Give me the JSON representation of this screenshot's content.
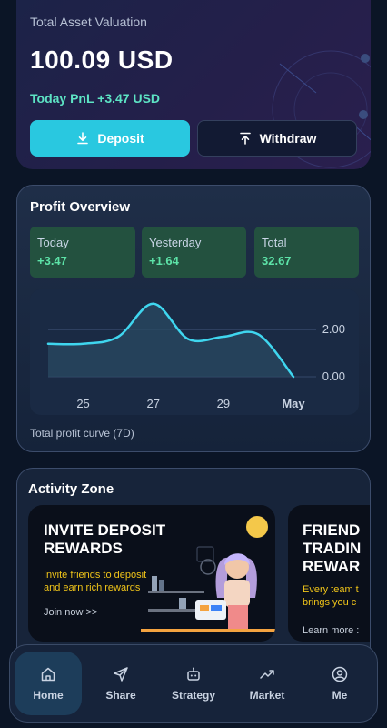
{
  "asset": {
    "title": "Total Asset Valuation",
    "amount": "100.09 USD",
    "pnl": "Today PnL +3.47 USD",
    "deposit_label": "Deposit",
    "withdraw_label": "Withdraw"
  },
  "profit": {
    "title": "Profit Overview",
    "stats": [
      {
        "label": "Today",
        "value": "+3.47"
      },
      {
        "label": "Yesterday",
        "value": "+1.64"
      },
      {
        "label": "Total",
        "value": "32.67"
      }
    ],
    "caption": "Total profit curve (7D)"
  },
  "chart_data": {
    "type": "area",
    "x_tick_labels": [
      "25",
      "27",
      "29",
      "May"
    ],
    "y_tick_labels": [
      "2.00",
      "0.00"
    ],
    "x": [
      "24",
      "25",
      "26",
      "27",
      "28",
      "29",
      "30",
      "May"
    ],
    "values": [
      1.4,
      1.4,
      1.7,
      3.1,
      1.6,
      1.7,
      1.8,
      0.0
    ],
    "ylim": [
      0,
      3.4
    ],
    "grid": true,
    "legend": "none",
    "color": "#3fd6ef",
    "title": "",
    "xlabel": "",
    "ylabel": ""
  },
  "activity": {
    "title": "Activity Zone",
    "promos": [
      {
        "title_lines": [
          "INVITE DEPOSIT",
          "REWARDS"
        ],
        "desc_lines": [
          "Invite friends to deposit",
          "and earn rich rewards"
        ],
        "link": "Join now >>"
      },
      {
        "title_lines": [
          "FRIEND",
          "TRADIN",
          "REWAR"
        ],
        "desc_lines": [
          "Every team t",
          "brings you c"
        ],
        "link": "Learn more :"
      }
    ]
  },
  "nav": {
    "items": [
      {
        "label": "Home",
        "icon": "home-icon",
        "active": true
      },
      {
        "label": "Share",
        "icon": "send-icon",
        "active": false
      },
      {
        "label": "Strategy",
        "icon": "robot-icon",
        "active": false
      },
      {
        "label": "Market",
        "icon": "trend-icon",
        "active": false
      },
      {
        "label": "Me",
        "icon": "user-icon",
        "active": false
      }
    ]
  },
  "colors": {
    "accent": "#29c8e0",
    "positive": "#5de3a8",
    "promo_yellow": "#f0c419"
  }
}
